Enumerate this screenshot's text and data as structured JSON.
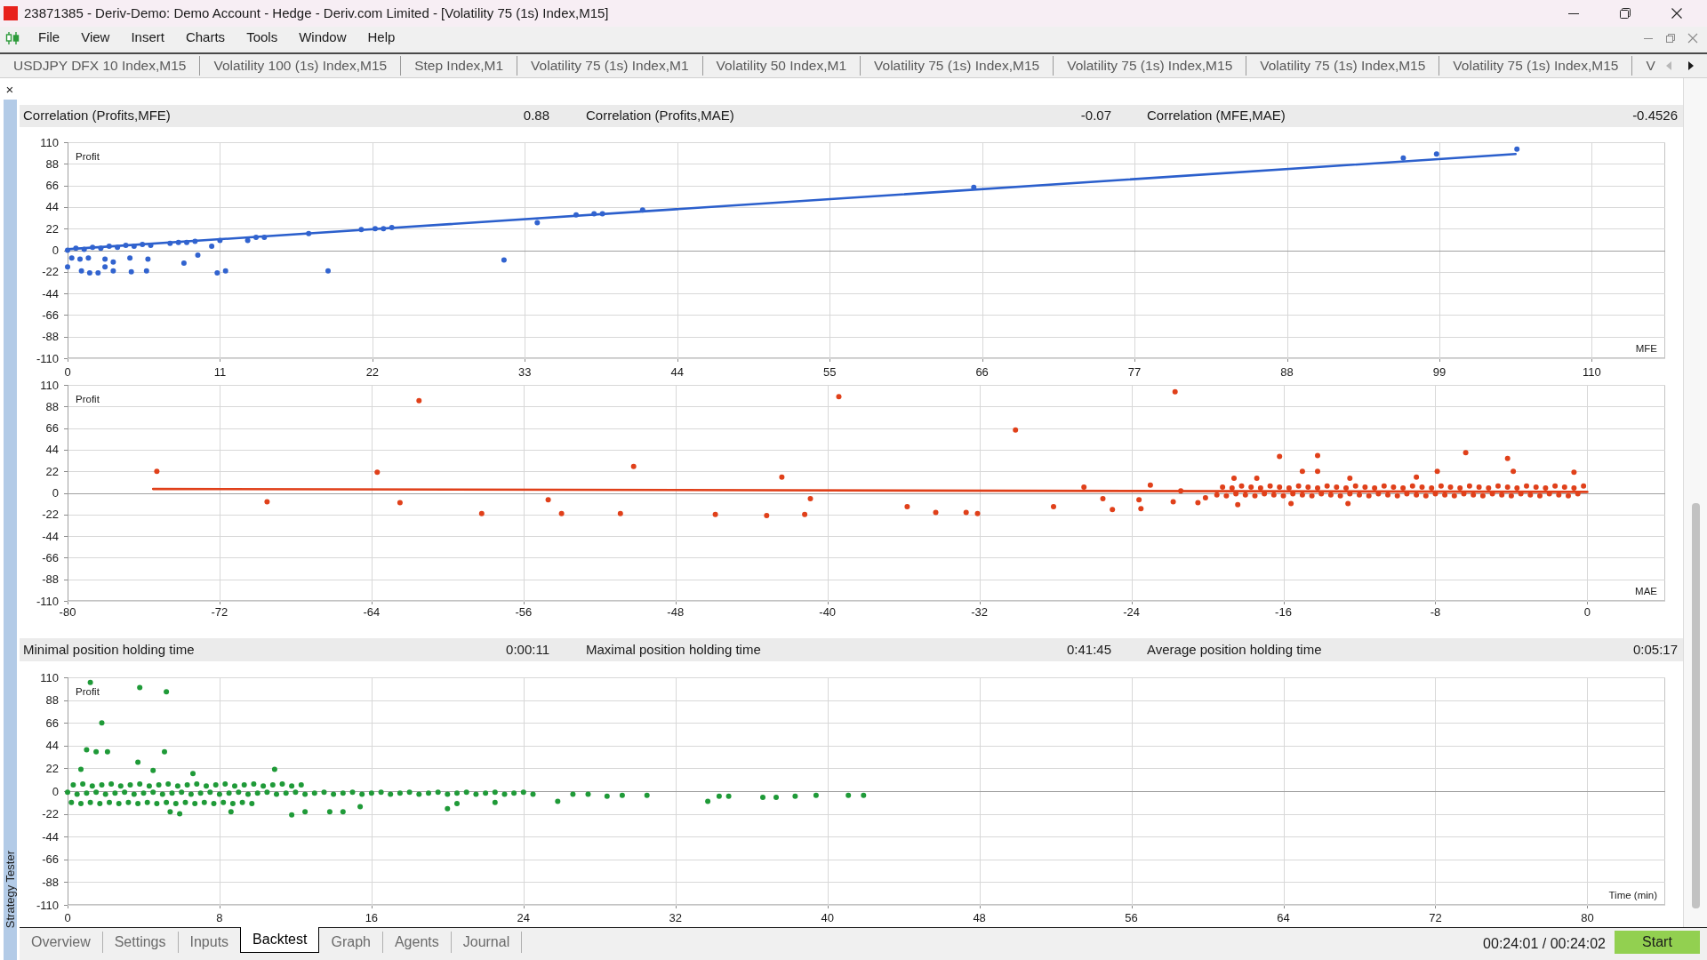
{
  "window": {
    "title": "23871385 - Deriv-Demo: Demo Account - Hedge - Deriv.com Limited - [Volatility 75 (1s) Index,M15]"
  },
  "menu": [
    "File",
    "View",
    "Insert",
    "Charts",
    "Tools",
    "Window",
    "Help"
  ],
  "chart_tabs": [
    "USDJPY DFX 10 Index,M15",
    "Volatility 100 (1s) Index,M15",
    "Step Index,M1",
    "Volatility 75 (1s) Index,M1",
    "Volatility 50 Index,M1",
    "Volatility 75 (1s) Index,M15",
    "Volatility 75 (1s) Index,M15",
    "Volatility 75 (1s) Index,M15",
    "Volatility 75 (1s) Index,M15",
    "V"
  ],
  "tab_scroll_buttons": [
    {
      "kind": "back",
      "disabled": true
    },
    {
      "kind": "forward",
      "disabled": false
    }
  ],
  "tester": {
    "close_label": "×",
    "panel_title": "Strategy Tester",
    "correlation_stats": [
      {
        "label": "Correlation (Profits,MFE)",
        "value": "0.88"
      },
      {
        "label": "Correlation (Profits,MAE)",
        "value": "-0.07"
      },
      {
        "label": "Correlation (MFE,MAE)",
        "value": "-0.4526"
      }
    ],
    "mfe_chart": {
      "chart_data": {
        "type": "scatter",
        "xlabel": "MFE",
        "ylabel": "Profit",
        "xlim": [
          0,
          115.3
        ],
        "ylim": [
          -110,
          110
        ],
        "xticks": [
          0,
          11,
          22,
          33,
          44,
          55,
          66,
          77,
          88,
          99,
          110
        ],
        "yticks": [
          110,
          88,
          66,
          44,
          22,
          0,
          -22,
          -44,
          -66,
          -88,
          -110
        ],
        "grid": true,
        "series": [
          {
            "type": "line",
            "color": "#2b5fcc",
            "x": [
              0,
              104.5
            ],
            "values": [
              1,
              98
            ]
          },
          {
            "color": "#3163cf",
            "x": [
              0,
              0.6,
              1.2,
              1.8,
              2.4,
              3,
              3.6,
              4.2,
              4.8,
              5.4,
              6,
              0.3,
              0.9,
              1.5,
              2.7,
              3.3,
              4.5,
              5.8,
              0,
              1,
              1.6,
              2.2,
              2.7,
              3.3,
              4.6,
              5.7,
              7.4,
              8,
              8.6,
              9.2,
              8.4,
              9.4,
              10.4,
              10.8,
              11.4,
              11,
              13,
              13.6,
              14.2,
              17.4,
              18.8,
              21.2,
              22.2,
              22.8,
              23.4,
              31.5,
              33.9,
              36.7,
              38,
              38.6,
              41.5,
              65.4,
              96.4,
              98.8,
              104.6
            ],
            "values": [
              0,
              2,
              1,
              3,
              2,
              4,
              3,
              5,
              4,
              6,
              5,
              -8,
              -9,
              -8,
              -9,
              -12,
              -8,
              -9,
              -17,
              -21,
              -23,
              -23,
              -17,
              -21,
              -22,
              -21,
              7,
              8,
              8,
              9,
              -13,
              -5,
              4,
              -23,
              -21,
              10,
              10,
              13,
              13,
              17,
              -21,
              21,
              22,
              22,
              23,
              -10,
              28,
              36,
              37,
              37,
              41,
              64,
              94,
              98,
              103
            ]
          }
        ]
      }
    },
    "mae_chart": {
      "chart_data": {
        "type": "scatter",
        "xlabel": "MAE",
        "ylabel": "Profit",
        "xlim": [
          -80,
          4.1
        ],
        "ylim": [
          -110,
          110
        ],
        "xticks": [
          -80,
          -72,
          -64,
          -56,
          -48,
          -40,
          -32,
          -24,
          -16,
          -8,
          0
        ],
        "yticks": [
          110,
          88,
          66,
          44,
          22,
          0,
          -22,
          -44,
          -66,
          -88,
          -110
        ],
        "grid": true,
        "series": [
          {
            "type": "line",
            "color": "#e0401a",
            "x": [
              -75.5,
              0
            ],
            "values": [
              4,
              1
            ]
          },
          {
            "color": "#e0401a",
            "x": [
              -75.3,
              -69.5,
              -63.7,
              -61.5,
              -62.5,
              -58.2,
              -54.7,
              -54,
              -50.9,
              -50.2,
              -45.9,
              -43.2,
              -42.4,
              -41.2,
              -40.9,
              -39.4,
              -35.8,
              -34.3,
              -32.7,
              -32.1,
              -30.1,
              -28.1,
              -26.5,
              -25.5,
              -25,
              -23.6,
              -23.5,
              -23,
              -21.7,
              -21.8,
              -21.4,
              -20.5,
              -20.1,
              -19.5,
              -19,
              -18.5,
              -18,
              -17.5,
              -17,
              -16.5,
              -16,
              -15.5,
              -15,
              -14.5,
              -14,
              -13.5,
              -13,
              -12.5,
              -12,
              -11.5,
              -11,
              -10.5,
              -10,
              -9.5,
              -9,
              -8.5,
              -8,
              -7.5,
              -7,
              -6.5,
              -6,
              -5.5,
              -5,
              -4.5,
              -4,
              -3.5,
              -3,
              -2.5,
              -2,
              -1.5,
              -1,
              -0.5,
              -19.2,
              -18.7,
              -18.2,
              -17.7,
              -17.2,
              -16.7,
              -16.2,
              -15.7,
              -15.2,
              -14.7,
              -14.2,
              -13.7,
              -13.2,
              -12.7,
              -12.2,
              -11.7,
              -11.2,
              -10.7,
              -10.2,
              -9.7,
              -9.2,
              -8.7,
              -8.2,
              -7.7,
              -7.2,
              -6.7,
              -6.2,
              -5.7,
              -5.2,
              -4.7,
              -4.2,
              -3.7,
              -3.2,
              -2.7,
              -2.2,
              -1.7,
              -1.2,
              -0.7,
              -0.2,
              -18.6,
              -16.2,
              -15,
              -14.2,
              -14.2,
              -12.5,
              -9,
              -7.9,
              -6.4,
              -4.2,
              -3.9,
              -0.7,
              -17.4,
              -18.4,
              -15.6,
              -12.6
            ],
            "values": [
              22,
              -9,
              21,
              94,
              -10,
              -21,
              -7,
              -21,
              -21,
              27,
              -22,
              -23,
              16,
              -22,
              -6,
              98,
              -14,
              -20,
              -20,
              -21,
              64,
              -14,
              6,
              -6,
              -17,
              -7,
              -16,
              8,
              103,
              -9,
              2,
              -10,
              -5,
              -2,
              -3,
              -1,
              -2,
              -3,
              -1,
              -2,
              -3,
              -1,
              -2,
              -3,
              -1,
              -2,
              -3,
              -1,
              -2,
              -3,
              -1,
              -2,
              -3,
              -1,
              -2,
              -3,
              -1,
              -2,
              -3,
              -1,
              -2,
              -3,
              -1,
              -2,
              -3,
              -1,
              -2,
              -3,
              -1,
              -2,
              -3,
              -1,
              6,
              5,
              7,
              6,
              5,
              7,
              6,
              5,
              7,
              6,
              5,
              7,
              6,
              5,
              7,
              6,
              5,
              7,
              6,
              5,
              7,
              6,
              5,
              7,
              6,
              5,
              7,
              6,
              5,
              7,
              6,
              5,
              7,
              6,
              5,
              7,
              6,
              5,
              7,
              15,
              37,
              22,
              38,
              22,
              15,
              16,
              22,
              41,
              35,
              22,
              21,
              15,
              -12,
              -11,
              -11
            ]
          }
        ]
      }
    },
    "holding_time_stats": [
      {
        "label": "Minimal position holding time",
        "value": "0:00:11"
      },
      {
        "label": "Maximal position holding time",
        "value": "0:41:45"
      },
      {
        "label": "Average position holding time",
        "value": "0:05:17"
      }
    ],
    "holding_time_chart": {
      "chart_data": {
        "type": "scatter",
        "xlabel": "Time (min)",
        "ylabel": "Profit",
        "xlim": [
          0,
          84.1
        ],
        "ylim": [
          -110,
          110
        ],
        "xticks": [
          0,
          8,
          16,
          24,
          32,
          40,
          48,
          56,
          64,
          72,
          80
        ],
        "yticks": [
          110,
          88,
          66,
          44,
          22,
          0,
          -22,
          -44,
          -66,
          -88,
          -110
        ],
        "grid": true,
        "series": [
          {
            "color": "#1f9a38",
            "x": [
              0,
              0.5,
              1,
              1.5,
              2,
              2.5,
              3,
              3.5,
              4,
              4.5,
              5,
              5.5,
              6,
              6.5,
              7,
              7.5,
              8,
              8.5,
              9,
              9.5,
              10,
              10.5,
              11,
              11.5,
              12,
              12.5,
              13,
              13.5,
              14,
              14.5,
              15,
              15.5,
              16,
              16.5,
              17,
              17.5,
              18,
              18.5,
              19,
              19.5,
              20,
              20.5,
              21,
              21.5,
              22,
              22.5,
              23,
              23.5,
              24,
              24.5,
              0.3,
              0.8,
              1.3,
              1.8,
              2.3,
              2.8,
              3.3,
              3.8,
              4.3,
              4.8,
              5.3,
              5.8,
              6.3,
              6.8,
              7.3,
              7.8,
              8.3,
              8.8,
              9.3,
              9.8,
              10.3,
              10.8,
              11.3,
              11.8,
              12.3,
              0.2,
              0.7,
              1.2,
              1.7,
              2.2,
              2.7,
              3.2,
              3.7,
              4.2,
              4.7,
              5.2,
              5.7,
              6.2,
              6.7,
              7.2,
              7.7,
              8.2,
              8.7,
              9.2,
              9.7,
              1.2,
              3.8,
              5.2,
              1.8,
              1,
              1.5,
              2.1,
              5.1,
              3.7,
              0.7,
              4.5,
              6.6,
              10.9,
              5.4,
              5.9,
              8.6,
              11.8,
              12.5,
              13.8,
              14.5,
              15.4,
              20,
              20.5,
              22.5,
              25.8,
              28.4,
              30.5,
              33.7,
              34.3,
              34.8,
              36.6,
              37.3,
              38.3,
              39.4,
              41.1,
              41.9,
              26.6,
              27.4,
              29.2
            ],
            "values": [
              -1,
              -3,
              -2,
              -1,
              -3,
              -2,
              -1,
              -3,
              -2,
              -1,
              -3,
              -2,
              -1,
              -3,
              -2,
              -1,
              -3,
              -2,
              -1,
              -3,
              -2,
              -1,
              -3,
              -2,
              -1,
              -3,
              -2,
              -1,
              -3,
              -2,
              -1,
              -3,
              -2,
              -1,
              -3,
              -2,
              -1,
              -3,
              -2,
              -1,
              -3,
              -2,
              -1,
              -3,
              -2,
              -1,
              -3,
              -2,
              -1,
              -3,
              6,
              7,
              5,
              6,
              7,
              5,
              6,
              7,
              5,
              6,
              7,
              5,
              6,
              7,
              5,
              6,
              7,
              5,
              6,
              7,
              5,
              6,
              7,
              5,
              6,
              -11,
              -12,
              -11,
              -12,
              -11,
              -12,
              -11,
              -12,
              -11,
              -12,
              -11,
              -12,
              -11,
              -12,
              -11,
              -12,
              -11,
              -12,
              -11,
              -12,
              105,
              100,
              96,
              66,
              40,
              38,
              38,
              38,
              28,
              21,
              20,
              17,
              21,
              -20,
              -22,
              -20,
              -23,
              -20,
              -20,
              -20,
              -15,
              -17,
              -12,
              -11,
              -10,
              -5,
              -4,
              -10,
              -5,
              -5,
              -6,
              -6,
              -5,
              -4,
              -4,
              -4,
              -3,
              -3,
              -4
            ]
          }
        ]
      }
    },
    "tabs": [
      {
        "label": "Overview",
        "selected": false
      },
      {
        "label": "Settings",
        "selected": false
      },
      {
        "label": "Inputs",
        "selected": false
      },
      {
        "label": "Backtest",
        "selected": true
      },
      {
        "label": "Graph",
        "selected": false
      },
      {
        "label": "Agents",
        "selected": false
      },
      {
        "label": "Journal",
        "selected": false
      }
    ],
    "elapsed": "00:24:01 / 00:24:02",
    "start_button": "Start"
  }
}
